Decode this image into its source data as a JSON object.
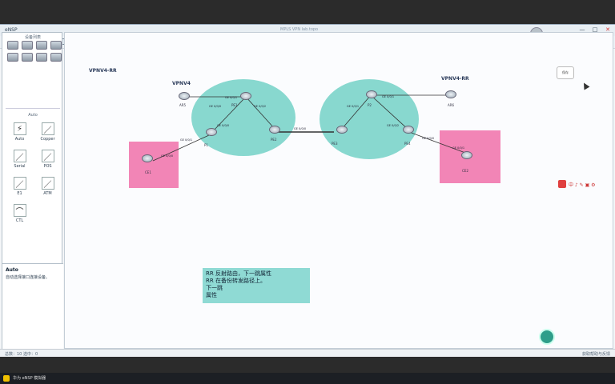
{
  "window": {
    "app_name": "eNSP",
    "title": "MPLS VPN lab.topo",
    "controls": [
      "—",
      "□",
      "✕"
    ]
  },
  "sidebar": {
    "devices_title": "设备列表",
    "cables_title": "Auto",
    "cables": [
      {
        "label": "Auto",
        "glyph": "⚡"
      },
      {
        "label": "Copper",
        "glyph": "／"
      },
      {
        "label": "Serial",
        "glyph": "／"
      },
      {
        "label": "POS",
        "glyph": "／"
      },
      {
        "label": "E1",
        "glyph": "／"
      },
      {
        "label": "ATM",
        "glyph": "／"
      },
      {
        "label": "CTL",
        "glyph": "⌒"
      }
    ],
    "desc_title": "Auto",
    "desc_text": "自动选择接口连接设备。"
  },
  "canvas": {
    "zone_labels": {
      "vpnv4_rr_left": "VPNV4-RR",
      "vpnv4": "VPNV4",
      "vpnv4_rr_right": "VPNV4-RR"
    },
    "routers": {
      "ar5": "AR5",
      "pe1": "PE1",
      "p1": "P1",
      "pe2": "PE2",
      "ce1": "CE1",
      "p2": "P2",
      "pe3": "PE3",
      "pe4": "PE4",
      "ar6": "AR6",
      "ce2": "CE2"
    },
    "ports": {
      "a": "GE 0/0/0",
      "b": "GE 0/0/1",
      "c": "GE 0/0/2",
      "d": "GE 0/0/0",
      "e": "GE 0/0/1",
      "f": "GE 0/0/0",
      "g": "GE 0/0/0",
      "h": "GE 0/0/1",
      "i": "GE 0/0/1",
      "j": "GE 0/0/2",
      "k": "GE 0/0/0",
      "l": "GE 0/0/1"
    },
    "mini_button": "保存",
    "note_lines": [
      "RR 反射路由，下一跳属性",
      "RR 在备份转发路径上。",
      "下一跳",
      "属性"
    ],
    "floatbar_text": "中 ♪ ✎ ▣ ⚙"
  },
  "statusbar": {
    "left": "总数：10 选中：0",
    "right": "获取帮助与反馈"
  },
  "taskbar": {
    "text": "华为 eNSP 模拟器"
  },
  "colors": {
    "ellipse": "#88d8cf",
    "pink": "#f285b6",
    "note": "#8fdad4"
  }
}
